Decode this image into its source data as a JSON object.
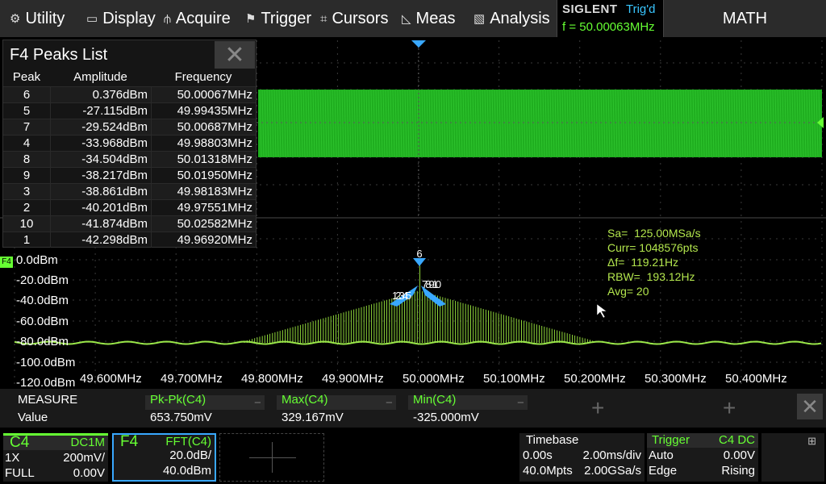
{
  "menu": {
    "utility": "Utility",
    "display": "Display",
    "acquire": "Acquire",
    "trigger": "Trigger",
    "cursors": "Cursors",
    "meas": "Meas",
    "analysis": "Analysis"
  },
  "status": {
    "brand": "SIGLENT",
    "trig_state": "Trig'd",
    "frequency": "f = 50.00063MHz"
  },
  "math_label": "MATH",
  "peaks_list": {
    "title": "F4 Peaks List",
    "columns": [
      "Peak",
      "Amplitude",
      "Frequency"
    ],
    "rows": [
      {
        "peak": "6",
        "amplitude": "0.376dBm",
        "frequency": "50.00067MHz"
      },
      {
        "peak": "5",
        "amplitude": "-27.115dBm",
        "frequency": "49.99435MHz"
      },
      {
        "peak": "7",
        "amplitude": "-29.524dBm",
        "frequency": "50.00687MHz"
      },
      {
        "peak": "4",
        "amplitude": "-33.968dBm",
        "frequency": "49.98803MHz"
      },
      {
        "peak": "8",
        "amplitude": "-34.504dBm",
        "frequency": "50.01318MHz"
      },
      {
        "peak": "9",
        "amplitude": "-38.217dBm",
        "frequency": "50.01950MHz"
      },
      {
        "peak": "3",
        "amplitude": "-38.861dBm",
        "frequency": "49.98183MHz"
      },
      {
        "peak": "2",
        "amplitude": "-40.201dBm",
        "frequency": "49.97551MHz"
      },
      {
        "peak": "10",
        "amplitude": "-41.874dBm",
        "frequency": "50.02582MHz"
      },
      {
        "peak": "1",
        "amplitude": "-42.298dBm",
        "frequency": "49.96920MHz"
      }
    ]
  },
  "fft_info": {
    "sa": "Sa=  125.00MSa/s",
    "curr": "Curr= 1048576pts",
    "df": "Δf=  119.21Hz",
    "rbw": "RBW=  193.12Hz",
    "avg": "Avg= 20"
  },
  "fft_channel_marker": "F4",
  "y_axis_labels": [
    "0.0dBm",
    "-20.0dBm",
    "-40.0dBm",
    "-60.0dBm",
    "-80.0dBm",
    "-100.0dBm",
    "-120.0dBm"
  ],
  "x_axis_labels": [
    "49.600MHz",
    "49.700MHz",
    "49.800MHz",
    "49.900MHz",
    "50.000MHz",
    "50.100MHz",
    "50.200MHz",
    "50.300MHz",
    "50.400MHz"
  ],
  "peak_markers": {
    "center_label": "6",
    "left_labels": "12345",
    "right_labels": "78910"
  },
  "measure": {
    "row_label_header": "MEASURE",
    "row_label_value": "Value",
    "items": [
      {
        "name": "Pk-Pk(C4)",
        "value": "653.750mV"
      },
      {
        "name": "Max(C4)",
        "value": "329.167mV"
      },
      {
        "name": "Min(C4)",
        "value": "-325.000mV"
      }
    ]
  },
  "channel_c4": {
    "name": "C4",
    "coupling": "DC1M",
    "probe": "1X",
    "scale": "200mV/",
    "bw": "FULL",
    "offset": "0.00V"
  },
  "channel_f4": {
    "name": "F4",
    "source": "FFT(C4)",
    "scale": "20.0dB/",
    "ref": "40.0dBm"
  },
  "timebase": {
    "title": "Timebase",
    "delay": "0.00s",
    "scale": "2.00ms/div",
    "points": "40.0Mpts",
    "rate": "2.00GSa/s"
  },
  "trigger": {
    "title": "Trigger",
    "source": "C4 DC",
    "mode": "Auto",
    "level": "0.00V",
    "type": "Edge",
    "slope": "Rising"
  },
  "colors": {
    "ch4": "#66ff33",
    "fft": "#9be84a",
    "accent": "#39c6ff"
  }
}
